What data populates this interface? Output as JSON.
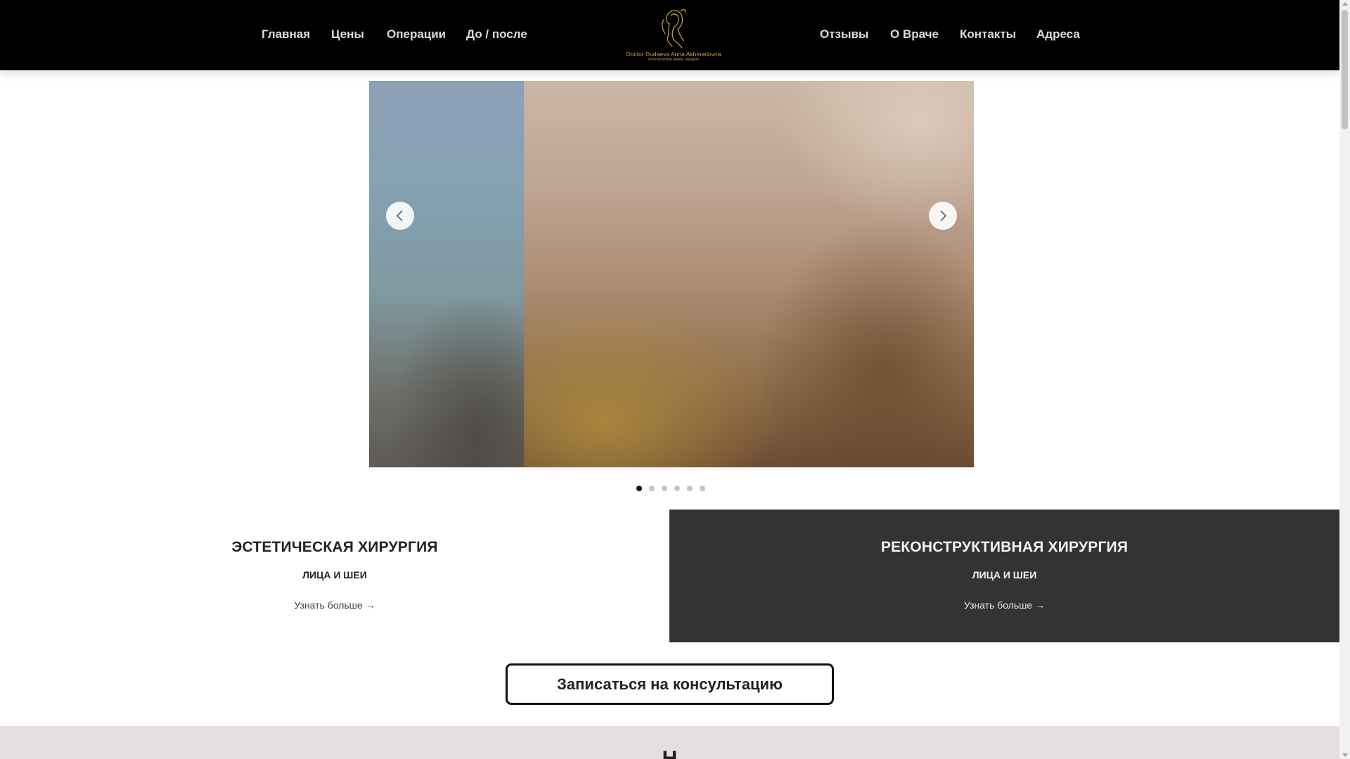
{
  "header": {
    "nav_left": [
      "Главная",
      "Цены",
      "Операции",
      "До / после"
    ],
    "nav_right": [
      "Отзывы",
      "О Враче",
      "Контакты",
      "Адреса"
    ],
    "logo": {
      "name": "Doctor Dudaeva Anna Akhmedovna",
      "subtitle": "reconstructive plastic surgeon"
    }
  },
  "slider": {
    "slide_count": 6,
    "active_index": 0
  },
  "categories": [
    {
      "title": "ЭСТЕТИЧЕСКАЯ ХИРУРГИЯ",
      "subtitle": "ЛИЦА И ШЕИ",
      "link": "Узнать больше →"
    },
    {
      "title": "РЕКОНСТРУКТИВНАЯ ХИРУРГИЯ",
      "subtitle": "ЛИЦА И ШЕИ",
      "link": "Узнать больше →"
    }
  ],
  "cta": {
    "label": "Записаться на консультацию"
  },
  "bottom": {
    "heading_partial": "Н"
  },
  "colors": {
    "header_bg": "#000000",
    "logo_gold": "#c9a44c",
    "dark_panel": "#333333",
    "bottom_bg": "#e4dfde"
  },
  "icons": {
    "prev": "chevron-left-icon",
    "next": "chevron-right-icon"
  }
}
